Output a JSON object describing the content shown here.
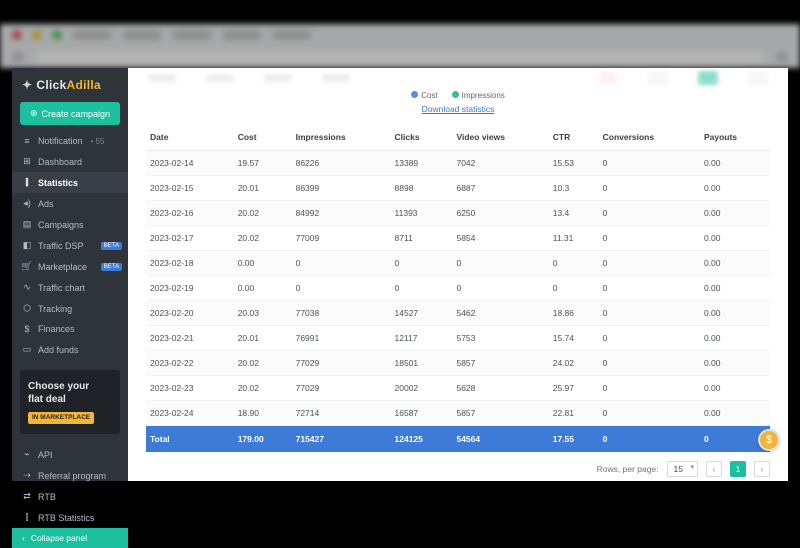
{
  "brand": {
    "a": "Click",
    "b": "Adilla"
  },
  "sidebar": {
    "create_label": "Create campaign",
    "items": [
      {
        "icon": "bell-icon",
        "glyph": "≡",
        "label": "Notification",
        "count": "• 55"
      },
      {
        "icon": "grid-icon",
        "glyph": "⊞",
        "label": "Dashboard"
      },
      {
        "icon": "chart-icon",
        "glyph": "⫿",
        "label": "Statistics",
        "active": true
      },
      {
        "icon": "sound-icon",
        "glyph": "◂)",
        "label": "Ads"
      },
      {
        "icon": "stack-icon",
        "glyph": "▤",
        "label": "Campaigns"
      },
      {
        "icon": "dsp-icon",
        "glyph": "◧",
        "label": "Traffic DSP",
        "beta": "BETA"
      },
      {
        "icon": "cart-icon",
        "glyph": "🛒",
        "label": "Marketplace",
        "beta": "BETA"
      },
      {
        "icon": "line-icon",
        "glyph": "∿",
        "label": "Traffic chart"
      },
      {
        "icon": "link-icon",
        "glyph": "⬡",
        "label": "Tracking"
      },
      {
        "icon": "dollar-icon",
        "glyph": "$",
        "label": "Finances"
      },
      {
        "icon": "card-icon",
        "glyph": "▭",
        "label": "Add funds"
      }
    ],
    "promo": {
      "line1": "Choose your",
      "line2": "flat deal",
      "chip": "IN MARKETPLACE"
    },
    "bottom": [
      {
        "icon": "api-icon",
        "glyph": "⌁",
        "label": "API"
      },
      {
        "icon": "ref-icon",
        "glyph": "⇢",
        "label": "Referral program"
      },
      {
        "icon": "rtb-icon",
        "glyph": "⇄",
        "label": "RTB"
      },
      {
        "icon": "rtbs-icon",
        "glyph": "⫿",
        "label": "RTB Statistics"
      }
    ],
    "collapse_label": "Collapse panel"
  },
  "legend": {
    "cost": "Cost",
    "impr": "Impressions"
  },
  "download_link": "Download statistics",
  "table": {
    "headers": [
      "Date",
      "Cost",
      "Impressions",
      "Clicks",
      "Video views",
      "CTR",
      "Conversions",
      "Payouts"
    ],
    "rows": [
      [
        "2023-02-14",
        "19.57",
        "86226",
        "13389",
        "7042",
        "15.53",
        "0",
        "0.00"
      ],
      [
        "2023-02-15",
        "20.01",
        "86399",
        "8898",
        "6887",
        "10.3",
        "0",
        "0.00"
      ],
      [
        "2023-02-16",
        "20.02",
        "84992",
        "11393",
        "6250",
        "13.4",
        "0",
        "0.00"
      ],
      [
        "2023-02-17",
        "20.02",
        "77009",
        "8711",
        "5854",
        "11.31",
        "0",
        "0.00"
      ],
      [
        "2023-02-18",
        "0.00",
        "0",
        "0",
        "0",
        "0",
        "0",
        "0.00"
      ],
      [
        "2023-02-19",
        "0.00",
        "0",
        "0",
        "0",
        "0",
        "0",
        "0.00"
      ],
      [
        "2023-02-20",
        "20.03",
        "77038",
        "14527",
        "5462",
        "18.86",
        "0",
        "0.00"
      ],
      [
        "2023-02-21",
        "20.01",
        "76991",
        "12117",
        "5753",
        "15.74",
        "0",
        "0.00"
      ],
      [
        "2023-02-22",
        "20.02",
        "77029",
        "18501",
        "5857",
        "24.02",
        "0",
        "0.00"
      ],
      [
        "2023-02-23",
        "20.02",
        "77029",
        "20002",
        "5628",
        "25.97",
        "0",
        "0.00"
      ],
      [
        "2023-02-24",
        "18.90",
        "72714",
        "16587",
        "5857",
        "22.81",
        "0",
        "0.00"
      ]
    ],
    "total": [
      "Total",
      "179.00",
      "715427",
      "124125",
      "54564",
      "17.55",
      "0",
      "0"
    ]
  },
  "pager": {
    "label": "Rows, per page:",
    "size": "15",
    "page": "1"
  }
}
